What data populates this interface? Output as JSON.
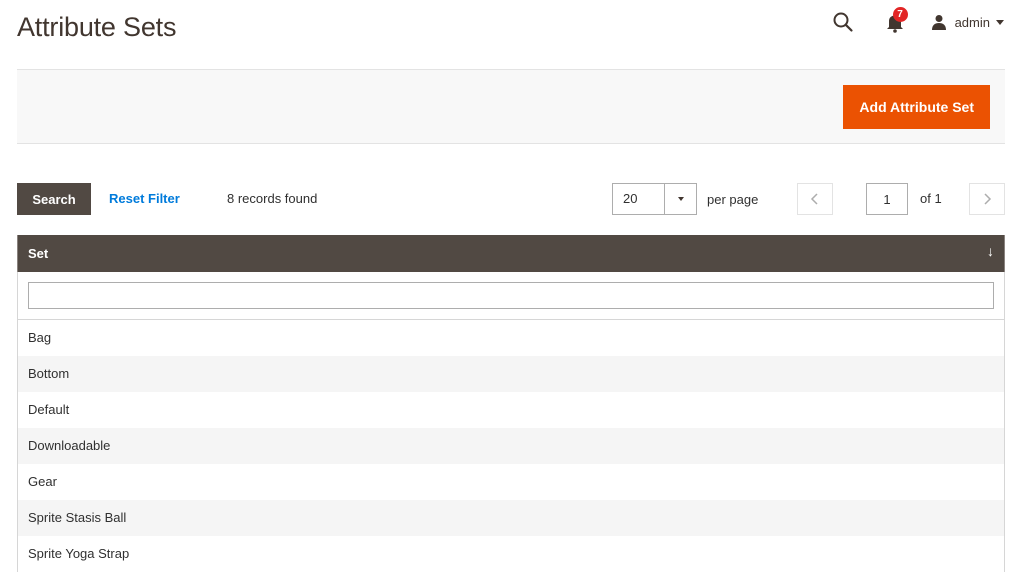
{
  "page": {
    "title": "Attribute Sets"
  },
  "header": {
    "notifications_count": "7",
    "user_name": "admin"
  },
  "actions": {
    "add_button": "Add Attribute Set"
  },
  "toolbar": {
    "search_label": "Search",
    "reset_label": "Reset Filter",
    "records_found": "8 records found",
    "per_page_value": "20",
    "per_page_label": "per page",
    "page_value": "1",
    "page_of": "of 1"
  },
  "grid": {
    "column_header": "Set",
    "sort_indicator": "↓",
    "filter_value": "",
    "rows": [
      "Bag",
      "Bottom",
      "Default",
      "Downloadable",
      "Gear",
      "Sprite Stasis Ball",
      "Sprite Yoga Strap"
    ]
  },
  "colors": {
    "accent": "#eb5202",
    "header_dark": "#514943",
    "link": "#007bdb",
    "badge": "#e22626"
  }
}
